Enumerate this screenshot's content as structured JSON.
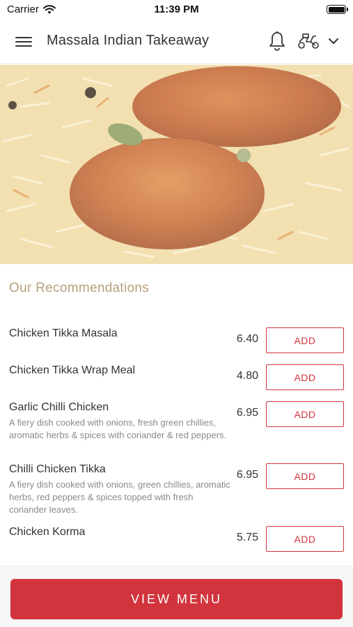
{
  "status_bar": {
    "carrier": "Carrier",
    "time": "11:39 PM"
  },
  "header": {
    "title": "Massala Indian Takeaway",
    "icons": [
      "menu-icon",
      "bell-icon",
      "scooter-icon",
      "chevron-down-icon"
    ]
  },
  "hero": {
    "image": "chicken-biryani-photo"
  },
  "recommendations": {
    "title": "Our Recommendations",
    "items": [
      {
        "name": "Chicken Tikka Masala",
        "description": "",
        "price": "6.40",
        "button": "ADD"
      },
      {
        "name": "Chicken Tikka Wrap Meal",
        "description": "",
        "price": "4.80",
        "button": "ADD"
      },
      {
        "name": "Garlic Chilli Chicken",
        "description": "A fiery dish cooked with onions, fresh green chillies, aromatic herbs & spices with coriander & red peppers.",
        "price": "6.95",
        "button": "ADD"
      },
      {
        "name": "Chilli Chicken Tikka",
        "description": "A fiery dish cooked with onions, green chillies, aromatic herbs, red peppers & spices topped with fresh coriander leaves.",
        "price": "6.95",
        "button": "ADD"
      },
      {
        "name": "Chicken Korma",
        "description": "",
        "price": "5.75",
        "button": "ADD"
      }
    ]
  },
  "footer": {
    "view_menu_label": "VIEW MENU"
  },
  "colors": {
    "accent": "#d2343d",
    "section_title": "#b8a07a",
    "text": "#333333",
    "muted": "#8a8a8a"
  }
}
